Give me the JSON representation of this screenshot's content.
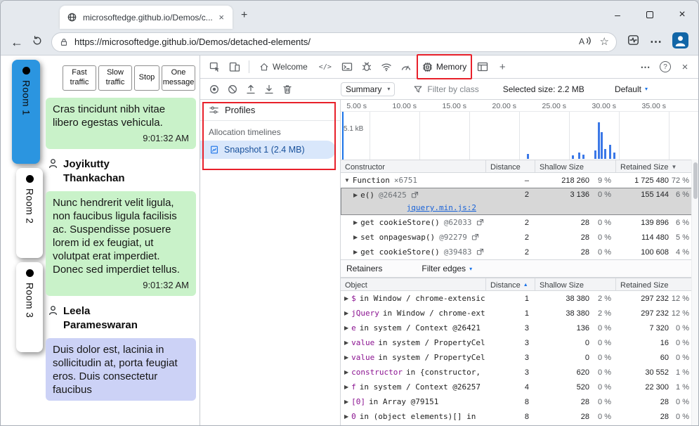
{
  "colors": {
    "annotation_red": "#e8202a",
    "accent_blue": "#1a73e8",
    "room_active_blue": "#2b95e0",
    "bubble_green": "#c9f2c9",
    "bubble_blue": "#ccd2f6",
    "selected_row_gray": "#d7d7d7"
  },
  "glyphs": {
    "close": "×",
    "minimize": "–",
    "plus": "+",
    "back": "←",
    "star": "☆",
    "more_h": "⋯",
    "help": "?",
    "caret_down": "▾",
    "sort_up": "▲",
    "sort_down": "▼",
    "tri_right": "▶",
    "tri_down": "▼",
    "elements": "</>",
    "read_aloud": "A"
  },
  "browser": {
    "tab_title": "microsoftedge.github.io/Demos/c...",
    "url": "https://microsoftedge.github.io/Demos/detached-elements/"
  },
  "chat": {
    "rooms": [
      {
        "label": "Room 1"
      },
      {
        "label": "Room 2"
      },
      {
        "label": "Room 3"
      }
    ],
    "controls": [
      {
        "label": "Fast traffic"
      },
      {
        "label": "Slow traffic"
      },
      {
        "label": "Stop"
      },
      {
        "label": "One message"
      }
    ],
    "message1": {
      "text": "Cras tincidunt nibh vitae libero egestas vehicula.",
      "time": "9:01:32 AM"
    },
    "sender1": "Joyikutty Thankachan",
    "message2": {
      "text": "Nunc hendrerit velit ligula, non faucibus ligula facilisis ac. Suspendisse posuere lorem id ex feugiat, ut volutpat erat imperdiet. Donec sed imperdiet tellus.",
      "time": "9:01:32 AM"
    },
    "sender2": "Leela Parameswaran",
    "message3": {
      "text": "Duis dolor est, lacinia in sollicitudin at, porta feugiat eros. Duis consectetur faucibus"
    }
  },
  "devtools": {
    "tabs": {
      "welcome": "Welcome",
      "memory": "Memory"
    },
    "toolbar": {
      "summary": "Summary",
      "filter_placeholder": "Filter by class",
      "selected_size": "Selected size: 2.2 MB",
      "default_label": "Default"
    },
    "sidebar": {
      "profiles": "Profiles",
      "section": "Allocation timelines",
      "snapshot": "Snapshot 1 (2.4 MB)"
    },
    "timeline": {
      "ticks": [
        "5.00 s",
        "10.00 s",
        "15.00 s",
        "20.00 s",
        "25.00 s",
        "30.00 s",
        "35.00 s"
      ],
      "size_label": "5.1 kB",
      "bars_seconds": [
        [
          20.8,
          7
        ],
        [
          25.3,
          5
        ],
        [
          25.9,
          9
        ],
        [
          26.3,
          6
        ],
        [
          27.5,
          12
        ],
        [
          27.9,
          52
        ],
        [
          28.15,
          38
        ],
        [
          28.5,
          14
        ],
        [
          29.0,
          20
        ],
        [
          29.4,
          9
        ]
      ]
    },
    "constructor_table": {
      "headers": {
        "constructor": "Constructor",
        "distance": "Distance",
        "shallow": "Shallow Size",
        "retained": "Retained Size"
      },
      "rows": [
        {
          "name": "Function",
          "count": "×6751",
          "distance": "–",
          "shallow": "218 260",
          "shallow_pct": "9 %",
          "retained": "1 725 480",
          "retained_pct": "72 %"
        },
        {
          "name": "e()",
          "id": "@26425",
          "link": "jquery.min.js:2",
          "distance": "2",
          "shallow": "3 136",
          "shallow_pct": "0 %",
          "retained": "155 144",
          "retained_pct": "6 %"
        },
        {
          "name": "get cookieStore()",
          "id": "@62033",
          "distance": "2",
          "shallow": "28",
          "shallow_pct": "0 %",
          "retained": "139 896",
          "retained_pct": "6 %"
        },
        {
          "name": "set onpageswap()",
          "id": "@92279",
          "distance": "2",
          "shallow": "28",
          "shallow_pct": "0 %",
          "retained": "114 480",
          "retained_pct": "5 %"
        },
        {
          "name": "get cookieStore()",
          "id": "@39483",
          "distance": "2",
          "shallow": "28",
          "shallow_pct": "0 %",
          "retained": "100 608",
          "retained_pct": "4 %"
        }
      ]
    },
    "retainers": {
      "title": "Retainers",
      "filter_edges": "Filter edges"
    },
    "object_table": {
      "headers": {
        "object": "Object",
        "distance": "Distance",
        "shallow": "Shallow Size",
        "retained": "Retained Size"
      },
      "rows": [
        {
          "name": "$",
          "rest": "in Window / chrome-extensic",
          "distance": "1",
          "shallow": "38 380",
          "shallow_pct": "2 %",
          "retained": "297 232",
          "retained_pct": "12 %"
        },
        {
          "name": "jQuery",
          "rest": "in Window / chrome-ext",
          "distance": "1",
          "shallow": "38 380",
          "shallow_pct": "2 %",
          "retained": "297 232",
          "retained_pct": "12 %"
        },
        {
          "name": "e",
          "rest": "in system / Context @26421",
          "distance": "3",
          "shallow": "136",
          "shallow_pct": "0 %",
          "retained": "7 320",
          "retained_pct": "0 %"
        },
        {
          "name": "value",
          "rest": "in system / PropertyCel",
          "distance": "3",
          "shallow": "0",
          "shallow_pct": "0 %",
          "retained": "16",
          "retained_pct": "0 %"
        },
        {
          "name": "value",
          "rest": "in system / PropertyCel",
          "distance": "3",
          "shallow": "0",
          "shallow_pct": "0 %",
          "retained": "60",
          "retained_pct": "0 %"
        },
        {
          "name": "constructor",
          "rest": "in {constructor,",
          "distance": "3",
          "shallow": "620",
          "shallow_pct": "0 %",
          "retained": "30 552",
          "retained_pct": "1 %"
        },
        {
          "name": "f",
          "rest": "in system / Context @26257",
          "distance": "4",
          "shallow": "520",
          "shallow_pct": "0 %",
          "retained": "22 300",
          "retained_pct": "1 %"
        },
        {
          "name": "[0]",
          "rest": "in Array @79151",
          "distance": "8",
          "shallow": "28",
          "shallow_pct": "0 %",
          "retained": "28",
          "retained_pct": "0 %"
        },
        {
          "name": "0",
          "rest": "in (object elements)[] in",
          "distance": "8",
          "shallow": "28",
          "shallow_pct": "0 %",
          "retained": "28",
          "retained_pct": "0 %"
        }
      ]
    }
  }
}
